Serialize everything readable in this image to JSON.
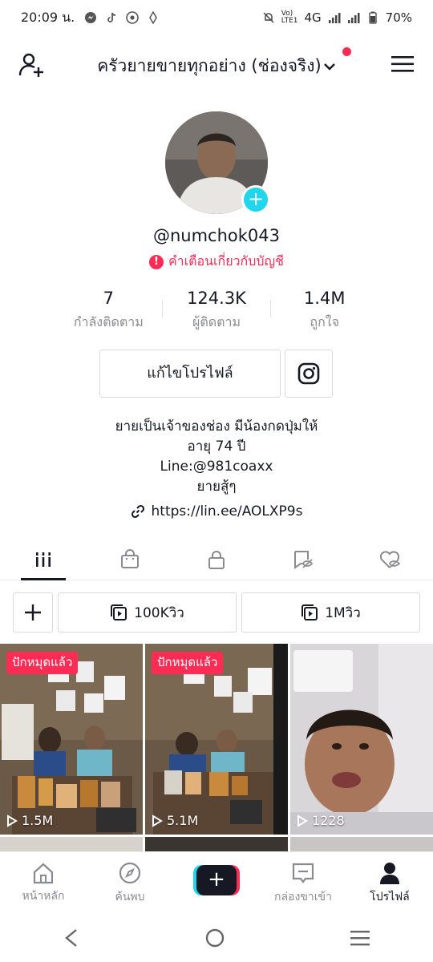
{
  "status_bar": {
    "time": "20:09 น.",
    "network": "4G",
    "battery": "70%"
  },
  "header": {
    "title": "ครัวยายขายทุกอย่าง (ช่องจริง)",
    "accent_color": "#fe2c55"
  },
  "profile": {
    "username": "@numchok043",
    "warning": "คำเตือนเกี่ยวกับบัญชี",
    "stats": [
      {
        "value": "7",
        "label": "กำลังติดตาม"
      },
      {
        "value": "124.3K",
        "label": "ผู้ติดตาม"
      },
      {
        "value": "1.4M",
        "label": "ถูกใจ"
      }
    ],
    "edit_label": "แก้ไขโปรไฟล์",
    "bio_lines": [
      "ยายเป็นเจ้าของช่อง มีน้องกดปุ่มให้",
      "อายุ 74 ปี",
      "Line:@981coaxx",
      "ยายสู้ๆ"
    ],
    "link": "https://lin.ee/AOLXP9s"
  },
  "tabs": [
    "videos-grid-icon",
    "shop-bag-icon",
    "lock-icon",
    "tagged-icon",
    "liked-icon"
  ],
  "filters": {
    "views1": "100Kวิว",
    "views2": "1Mวิว"
  },
  "videos": [
    {
      "pinned": "ปักหมุดแล้ว",
      "plays": "1.5M"
    },
    {
      "pinned": "ปักหมุดแล้ว",
      "plays": "5.1M"
    },
    {
      "pinned": "",
      "plays": "1228"
    }
  ],
  "bottom_nav": {
    "home": "หน้าหลัก",
    "discover": "ค้นพบ",
    "inbox": "กล่องขาเข้า",
    "profile": "โปรไฟล์"
  }
}
